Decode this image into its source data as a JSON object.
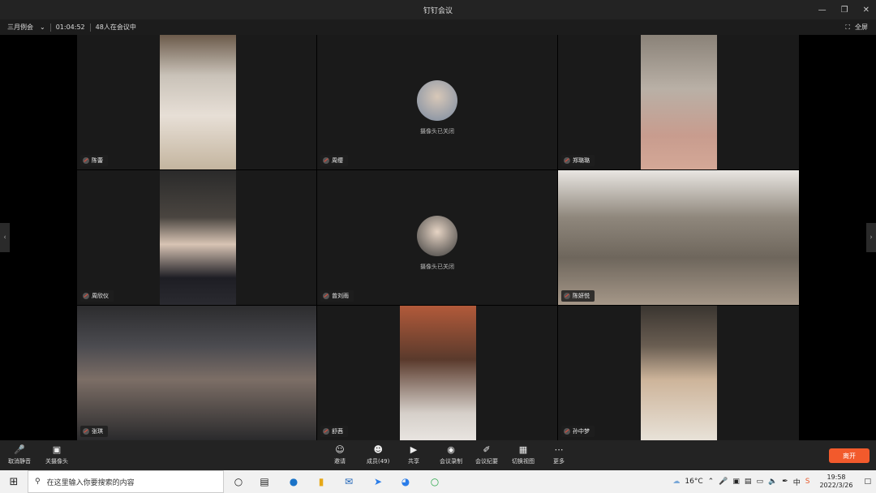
{
  "window": {
    "title": "钉钉会议"
  },
  "meeting": {
    "name": "三月例会",
    "duration": "01:04:52",
    "participants_status": "48人在会议中",
    "fullscreen_label": "全屏"
  },
  "participants": [
    {
      "name": "陈蕾",
      "camera_off": false
    },
    {
      "name": "周缨",
      "camera_off": true,
      "camera_off_label": "摄像头已关闭"
    },
    {
      "name": "郑璐璐",
      "camera_off": false
    },
    {
      "name": "周欣仪",
      "camera_off": false
    },
    {
      "name": "曾刘雨",
      "camera_off": true,
      "camera_off_label": "摄像头已关闭"
    },
    {
      "name": "陈妍悦",
      "camera_off": false
    },
    {
      "name": "张琪",
      "camera_off": false
    },
    {
      "name": "舒茜",
      "camera_off": false
    },
    {
      "name": "孙中梦",
      "camera_off": false
    }
  ],
  "toolbar": {
    "unmute": "取消静音",
    "camera": "关摄像头",
    "invite": "邀请",
    "members": "成员(49)",
    "share": "共享",
    "record": "会议录制",
    "minutes": "会议纪要",
    "view": "切换视图",
    "more": "更多",
    "leave": "离开"
  },
  "taskbar": {
    "search_placeholder": "在这里输入你要搜索的内容",
    "weather": "16°C",
    "ime": "中",
    "time": "19:58",
    "date": "2022/3/26"
  },
  "colors": {
    "leave": "#f25a2c",
    "toolbar_bg": "#232323"
  }
}
